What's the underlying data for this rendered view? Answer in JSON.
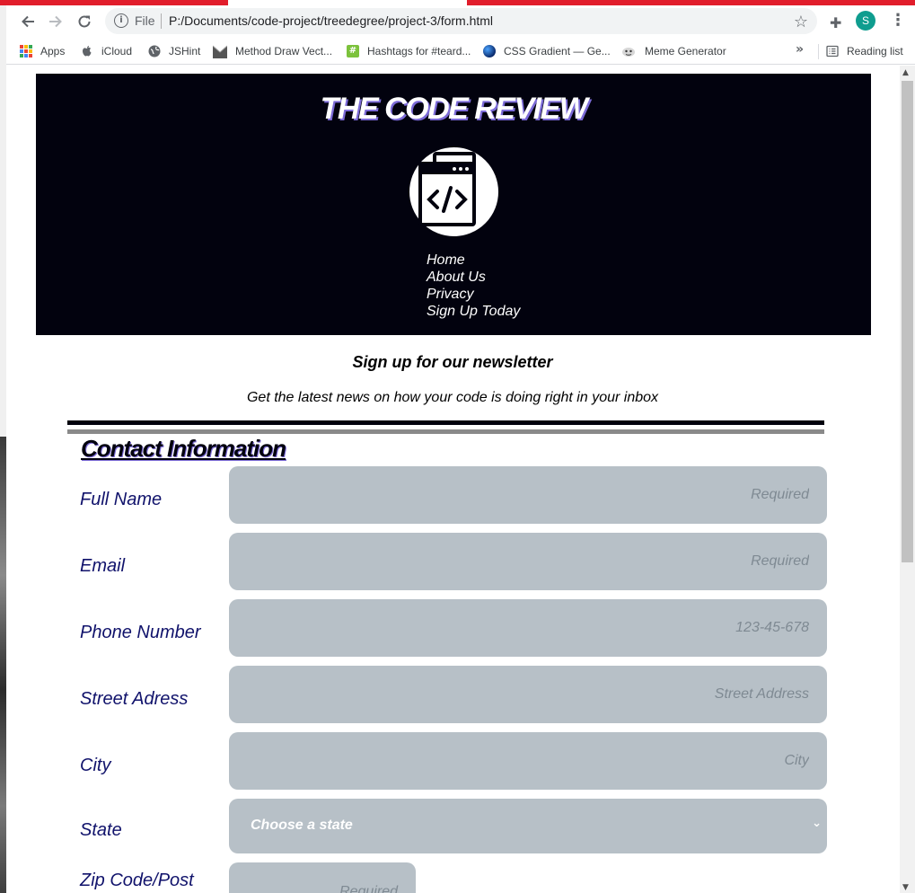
{
  "browser": {
    "address": {
      "scheme_label": "File",
      "url": "P:/Documents/code-project/treedegree/project-3/form.html"
    },
    "profile_initial": "S",
    "bookmarks": [
      {
        "label": "Apps",
        "icon": "apps-grid-icon"
      },
      {
        "label": "iCloud",
        "icon": "apple-icon"
      },
      {
        "label": "JSHint",
        "icon": "globe-icon"
      },
      {
        "label": "Method Draw Vect...",
        "icon": "method-draw-icon"
      },
      {
        "label": "Hashtags for #teard...",
        "icon": "hashtag-icon"
      },
      {
        "label": "CSS Gradient — Ge...",
        "icon": "gradient-icon"
      },
      {
        "label": "Meme Generator",
        "icon": "meme-icon"
      }
    ],
    "reading_list": "Reading list",
    "colors": {
      "tab_strip": "#e11d2b",
      "profile": "#0f9d8f"
    }
  },
  "page": {
    "site_title": "THE CODE REVIEW",
    "nav": [
      "Home",
      "About Us",
      "Privacy",
      "Sign Up Today"
    ],
    "newsletter_title": "Sign up for our newsletter",
    "newsletter_subtitle": "Get the latest news on how your code is doing right in your inbox",
    "contact_heading": "Contact Information",
    "fields": {
      "full_name": {
        "label": "Full Name",
        "placeholder": "Required"
      },
      "email": {
        "label": "Email",
        "placeholder": "Required"
      },
      "phone": {
        "label": "Phone Number",
        "placeholder": "123-45-678"
      },
      "street": {
        "label": "Street Adress",
        "placeholder": "Street Address"
      },
      "city": {
        "label": "City",
        "placeholder": "City"
      },
      "state": {
        "label": "State",
        "selected": "Choose a state"
      },
      "zip": {
        "label": "Zip Code/Post",
        "placeholder": "Required"
      }
    },
    "colors": {
      "header_bg": "#02020e",
      "input_bg": "#b7c0c7",
      "label_color": "#10126b"
    }
  }
}
